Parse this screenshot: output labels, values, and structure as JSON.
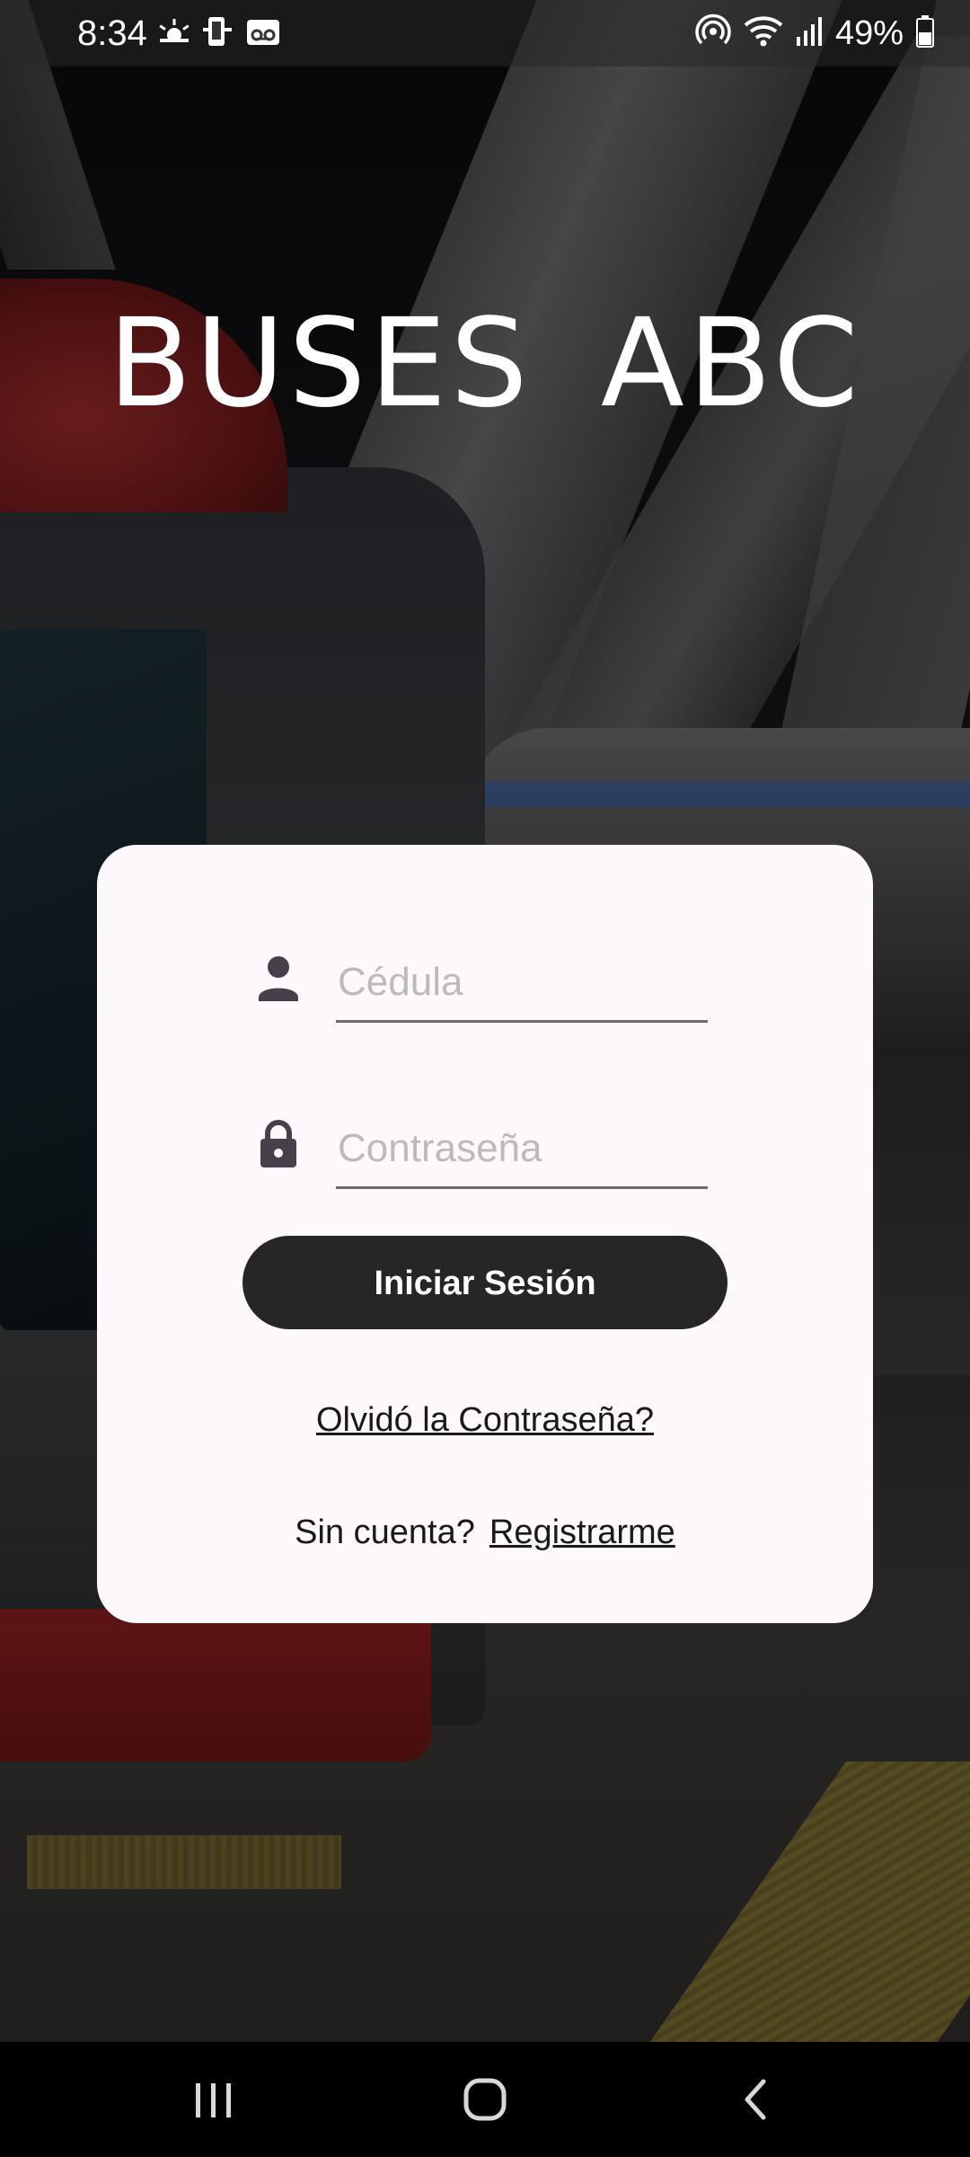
{
  "status_bar": {
    "time": "8:34",
    "battery_percent": "49%",
    "icons_left": [
      "weather-sunrise-icon",
      "phone-sync-icon",
      "voicemail-icon"
    ],
    "icons_right": [
      "hotspot-icon",
      "wifi-icon",
      "signal-icon",
      "battery-icon"
    ]
  },
  "app": {
    "title": "BUSES ABC"
  },
  "login": {
    "cedula_placeholder": "Cédula",
    "cedula_value": "",
    "password_placeholder": "Contraseña",
    "password_value": "",
    "submit_label": "Iniciar Sesión",
    "forgot_label": "Olvidó la Contraseña?",
    "no_account_label": "Sin cuenta?",
    "register_label": "Registrarme"
  },
  "nav_bar": {
    "buttons": [
      "recents-icon",
      "home-icon",
      "back-icon"
    ]
  },
  "colors": {
    "card_background": "#fdf8fc",
    "button_background": "#262628",
    "button_text": "#ffffff",
    "placeholder": "#bcbabc",
    "underline": "#6e6a6e"
  }
}
